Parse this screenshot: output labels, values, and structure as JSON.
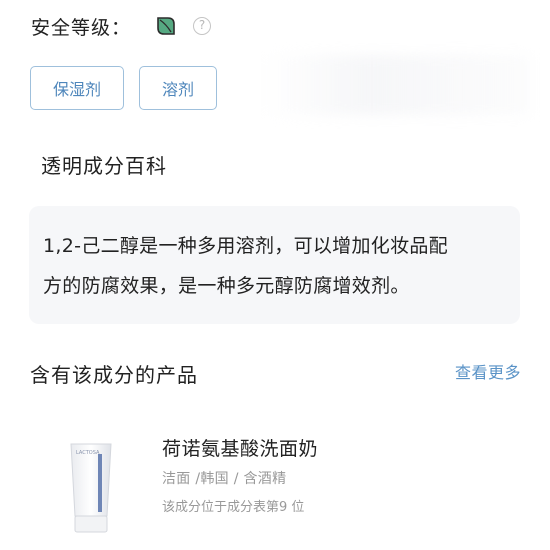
{
  "safety": {
    "label": "安全等级：",
    "leaf_color": "#56a982",
    "help_symbol": "?"
  },
  "tags": [
    {
      "label": "保湿剂"
    },
    {
      "label": "溶剂"
    }
  ],
  "encyclopedia": {
    "title": "透明成分百科",
    "description_line1": "1,2-己二醇是一种多用溶剂，可以增加化妆品配",
    "description_line2": "方的防腐效果，是一种多元醇防腐增效剂。"
  },
  "products": {
    "title": "含有该成分的产品",
    "see_more": "查看更多",
    "items": [
      {
        "name": "荷诺氨基酸洗面奶",
        "meta": "洁面 /韩国 / 含酒精",
        "rank": "该成分位于成分表第9 位",
        "image_text": "LACTOSA"
      }
    ]
  },
  "colors": {
    "accent": "#5a93c7",
    "tag_border": "#9fc0dc",
    "card_bg": "#f6f7f9"
  }
}
